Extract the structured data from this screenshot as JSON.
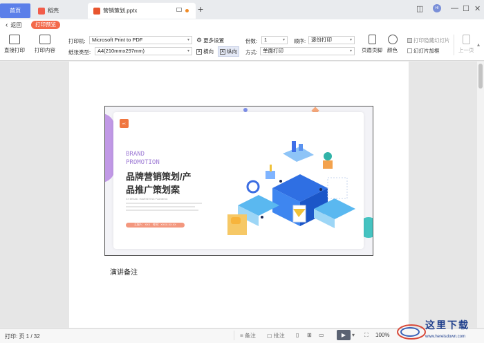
{
  "tabs": {
    "home": "首页",
    "shell": "稻壳",
    "file": "营销策划.pptx"
  },
  "toolbar": {
    "back": "返回",
    "print_preview": "打印预览",
    "direct_print": "直接打印",
    "print_content": "打印内容",
    "printer_label": "打印机:",
    "printer_value": "Microsoft Print to PDF",
    "paper_label": "纸张类型:",
    "paper_value": "A4(210mmx297mm)",
    "more_settings": "更多设置",
    "landscape": "横向",
    "portrait": "纵向",
    "copies_label": "份数:",
    "copies_value": "1",
    "order_label": "顺序:",
    "order_value": "逐份打印",
    "mode_label": "方式:",
    "mode_value": "单面打印",
    "header_footer": "页眉页脚",
    "color": "颜色",
    "print_hidden": "打印隐藏幻灯片",
    "slide_frame": "幻灯片加框",
    "prev_page": "上一页"
  },
  "slide": {
    "brand_line1": "BRAND",
    "brand_line2": "PROMOTION",
    "title_line1": "品牌营销策划/产",
    "title_line2": "品推广策划案",
    "subtitle": "XX BRAND / MARKETING PLANNING",
    "presenter": "汇报人：XXX　时间：XXXX.XX.XX"
  },
  "notes_label": "演讲备注",
  "status": {
    "page": "打印: 页 1 / 32",
    "notes": "备注",
    "annotate": "批注",
    "zoom": "100%"
  },
  "watermark": {
    "text": "这里下载",
    "url": "www.hereisdown.com"
  },
  "colors": {
    "accent_blue": "#5b7fe9",
    "accent_orange": "#f36a4b",
    "brand_purple": "#9a7bd8"
  }
}
